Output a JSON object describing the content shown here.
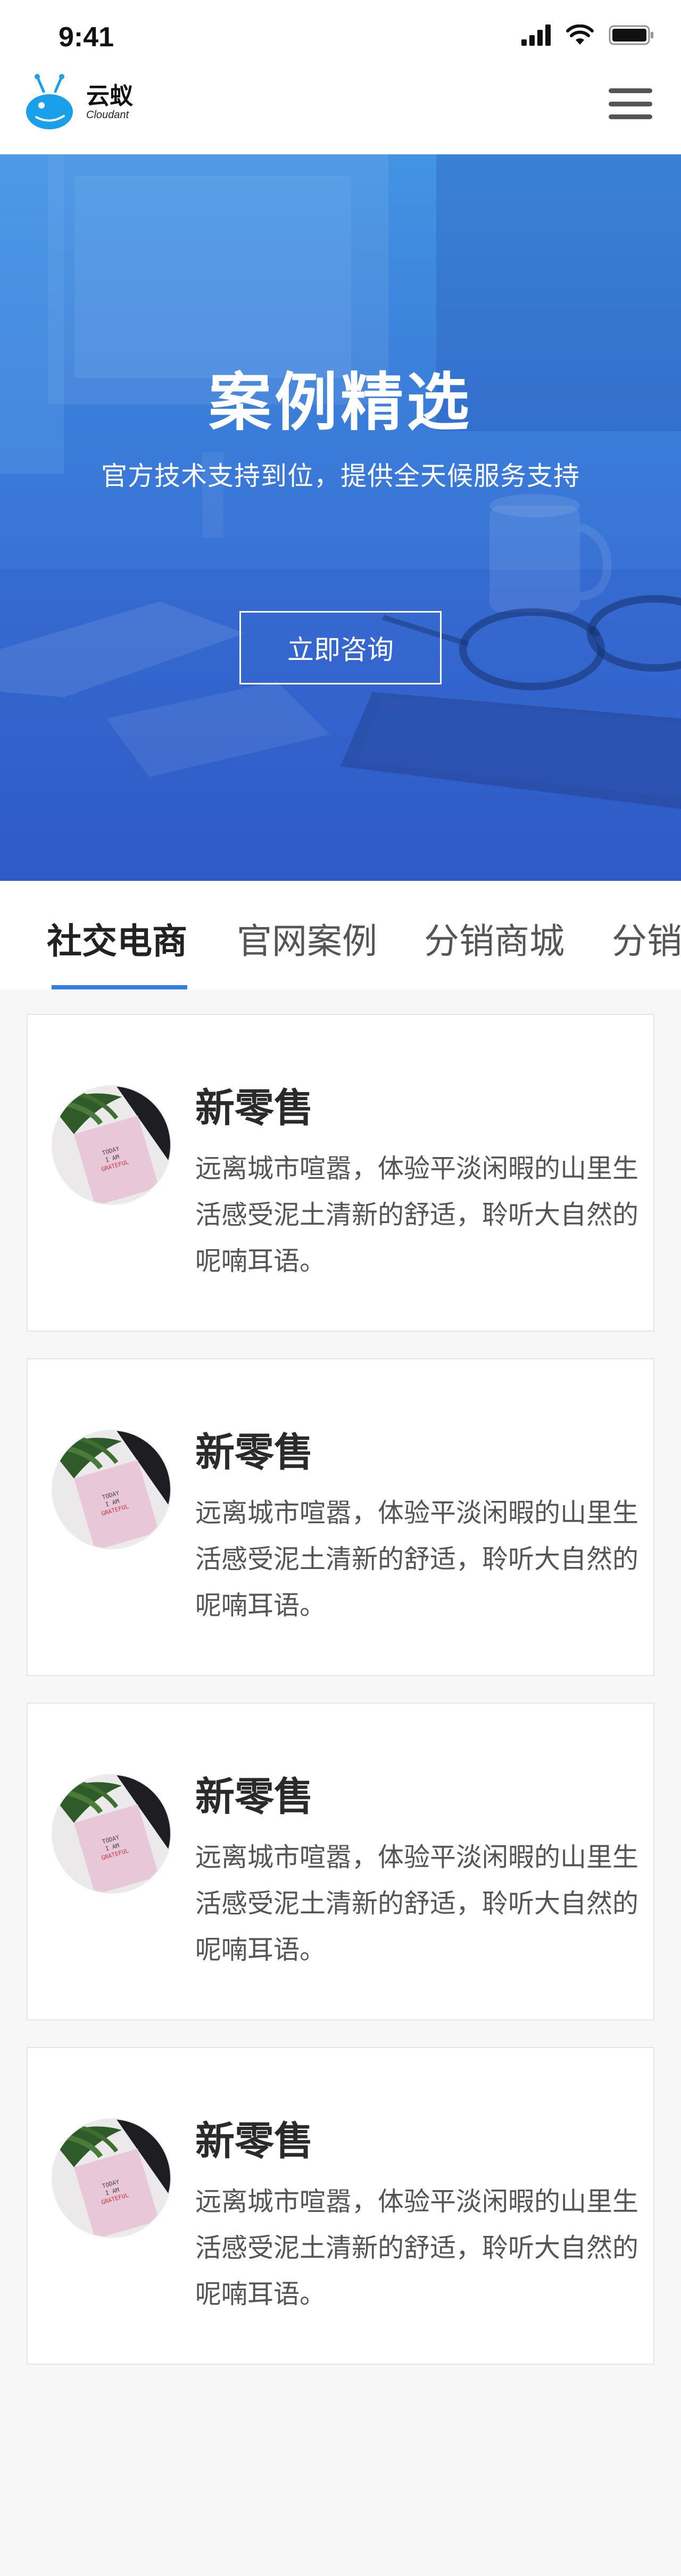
{
  "status_bar": {
    "time": "9:41",
    "icons": [
      "signal-icon",
      "wifi-icon",
      "battery-icon"
    ]
  },
  "header": {
    "logo_cn": "云蚁",
    "logo_en": "Cloudant",
    "menu_icon": "hamburger-menu-icon"
  },
  "hero": {
    "title": "案例精选",
    "subtitle": "官方技术支持到位，提供全天候服务支持",
    "button_label": "立即咨询"
  },
  "tabs": [
    {
      "label": "社交电商",
      "active": true
    },
    {
      "label": "官网案例",
      "active": false
    },
    {
      "label": "分销商城",
      "active": false
    },
    {
      "label": "分销",
      "active": false
    }
  ],
  "cards": [
    {
      "title": "新零售",
      "description": "远离城市喧嚣，体验平淡闲暇的山里生活感受泥土清新的舒适，聆听大自然的呢喃耳语。"
    },
    {
      "title": "新零售",
      "description": "远离城市喧嚣，体验平淡闲暇的山里生活感受泥土清新的舒适，聆听大自然的呢喃耳语。"
    },
    {
      "title": "新零售",
      "description": "远离城市喧嚣，体验平淡闲暇的山里生活感受泥土清新的舒适，聆听大自然的呢喃耳语。"
    },
    {
      "title": "新零售",
      "description": "远离城市喧嚣，体验平淡闲暇的山里生活感受泥土清新的舒适，聆听大自然的呢喃耳语。"
    }
  ],
  "colors": {
    "accent": "#2f7de6",
    "logo_blue": "#1aa0ea",
    "hero_top": "#4aa0e8",
    "hero_bottom": "#3152c2"
  }
}
